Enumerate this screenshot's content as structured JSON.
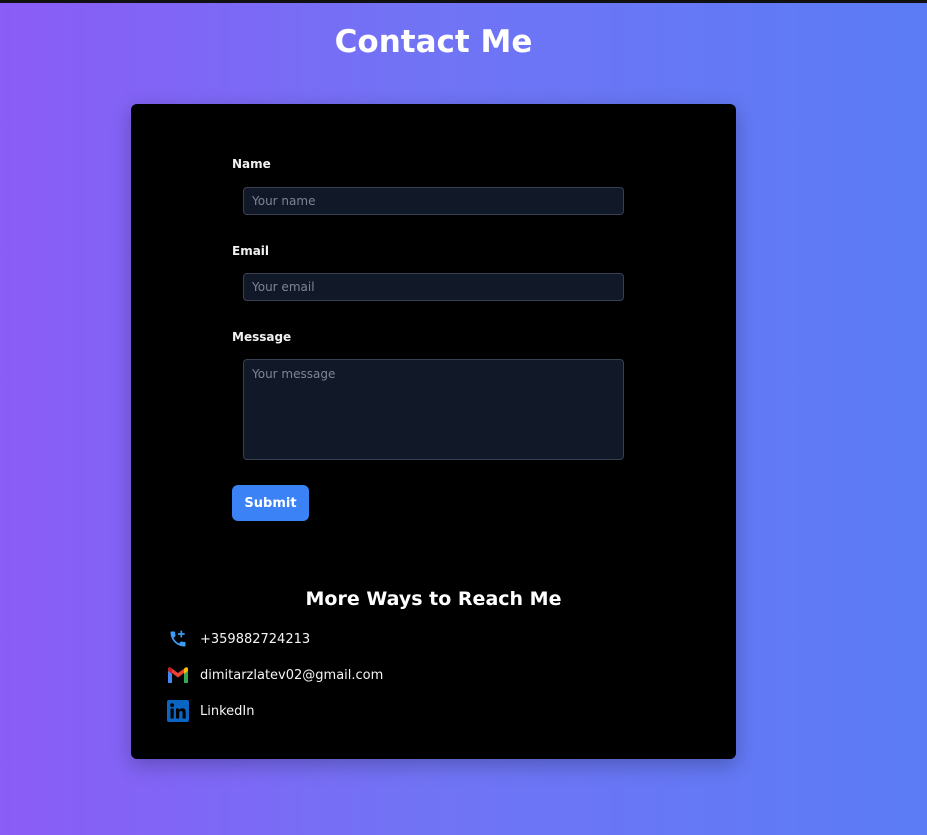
{
  "page": {
    "title": "Contact Me"
  },
  "form": {
    "name_label": "Name",
    "name_placeholder": "Your name",
    "email_label": "Email",
    "email_placeholder": "Your email",
    "message_label": "Message",
    "message_placeholder": "Your message",
    "submit_label": "Submit"
  },
  "more_ways": {
    "title": "More Ways to Reach Me",
    "items": [
      {
        "icon": "phone-icon",
        "text": "+359882724213"
      },
      {
        "icon": "gmail-icon",
        "text": "dimitarzlatev02@gmail.com"
      },
      {
        "icon": "linkedin-icon",
        "text": "LinkedIn"
      }
    ]
  },
  "colors": {
    "accent": "#3b82f6",
    "card": "#000000",
    "input_bg": "#111827",
    "gradient_start": "#8b5cf6",
    "gradient_end": "#5b7cf5"
  }
}
